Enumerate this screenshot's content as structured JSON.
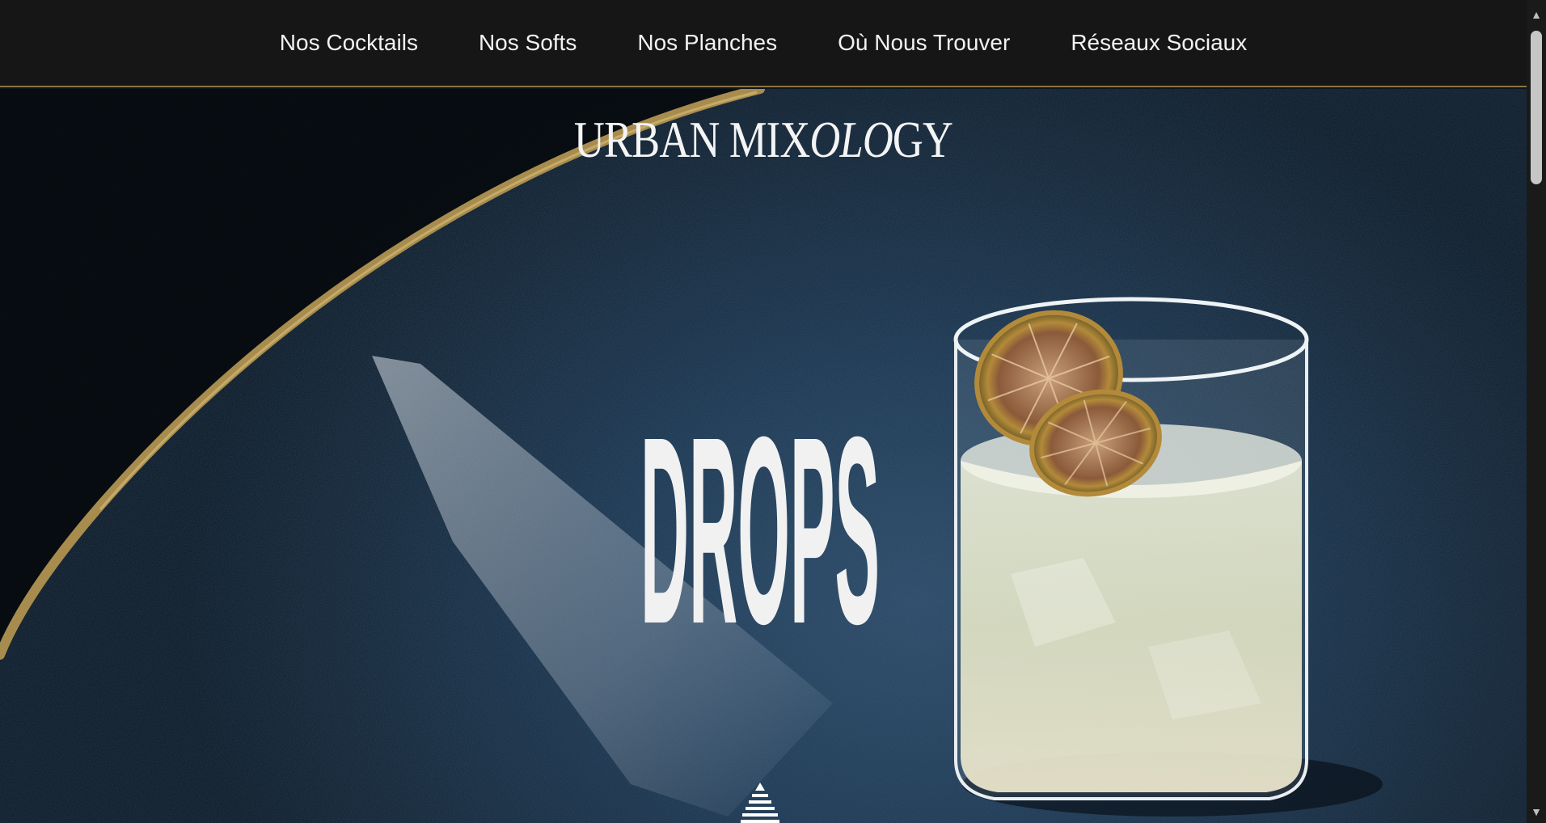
{
  "nav": {
    "items": [
      {
        "label": "Nos Cocktails"
      },
      {
        "label": "Nos Softs"
      },
      {
        "label": "Nos Planches"
      },
      {
        "label": "Où Nous Trouver"
      },
      {
        "label": "Réseaux Sociaux"
      }
    ]
  },
  "hero": {
    "brand": {
      "part1": "URBAN MIX",
      "part2": "OLO",
      "part3": "GY"
    },
    "headline": "DROPS",
    "image": "cocktail-glass-on-slate",
    "scroll_icon": "chevron-stack-icon"
  },
  "colors": {
    "nav_bg": "#161616",
    "nav_border": "#8a7444",
    "nav_text": "#f2f2f2",
    "hero_text": "#f4f4f4",
    "gold_ring": "#a88c4e",
    "slate": "#1b3550"
  }
}
